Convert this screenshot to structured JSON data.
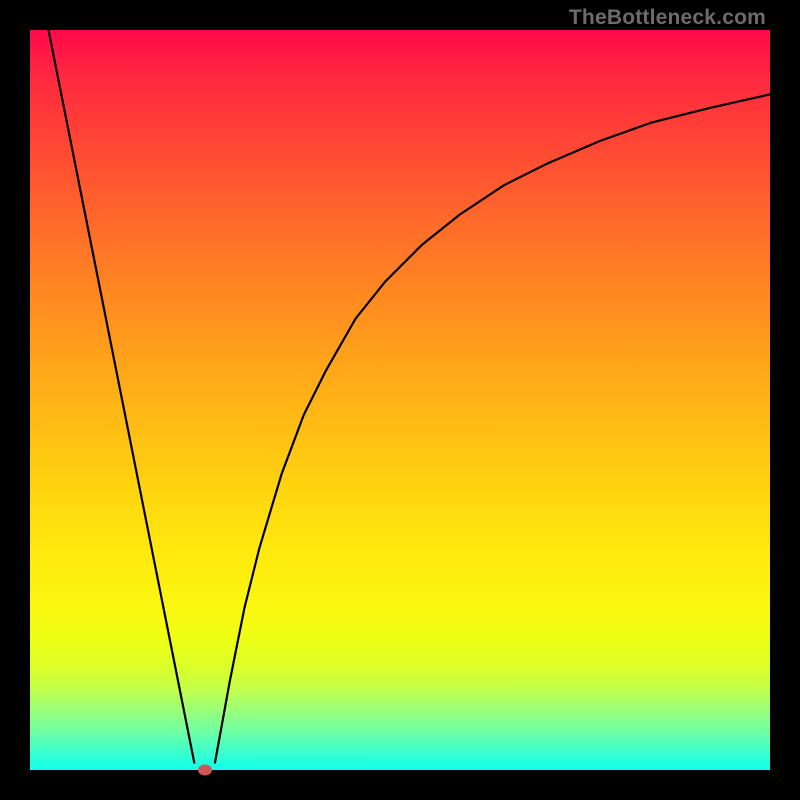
{
  "watermark": "TheBottleneck.com",
  "colors": {
    "black": "#000000",
    "stroke": "#000000",
    "marker": "#c75a55",
    "gradient_top": "#ff0a4b",
    "gradient_bottom": "#14ffe9"
  },
  "chart_data": {
    "type": "line",
    "title": "",
    "xlabel": "",
    "ylabel": "",
    "xlim": [
      0,
      100
    ],
    "ylim": [
      0,
      100
    ],
    "grid": false,
    "legend": false,
    "background_gradient": "vertical red→yellow→green",
    "marker": {
      "x": 23.6,
      "y": 0,
      "color": "#c75a55"
    },
    "series": [
      {
        "name": "left-descending-line",
        "type": "line",
        "x": [
          2.5,
          22.2
        ],
        "y": [
          100,
          1
        ]
      },
      {
        "name": "right-ascending-curve",
        "type": "line",
        "x": [
          25.0,
          27,
          29,
          31,
          34,
          37,
          40,
          44,
          48,
          53,
          58,
          64,
          70,
          77,
          84,
          92,
          100
        ],
        "y": [
          1,
          12,
          22,
          30,
          40,
          48,
          54,
          61,
          66,
          71,
          75,
          79,
          82,
          85,
          87.5,
          89.5,
          91.3
        ]
      }
    ]
  }
}
